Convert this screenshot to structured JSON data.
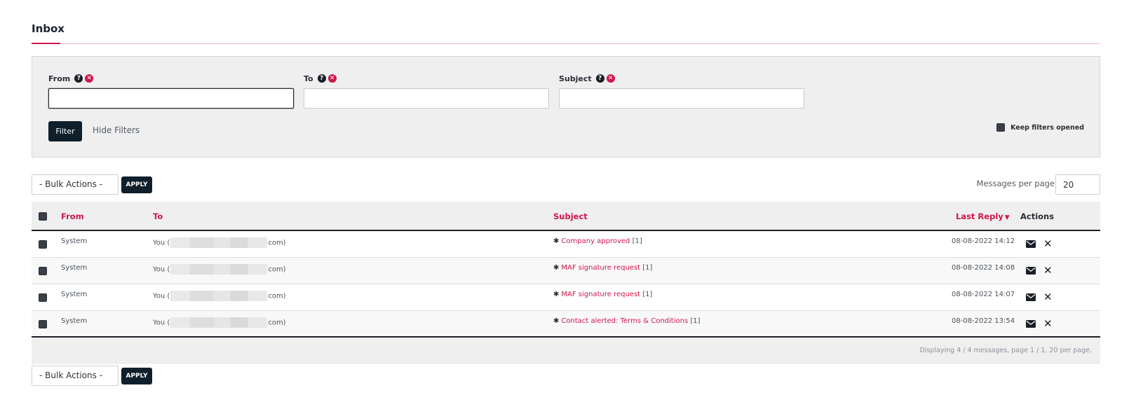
{
  "page": {
    "title": "Inbox"
  },
  "filters": {
    "from_label": "From",
    "to_label": "To",
    "subject_label": "Subject",
    "from_value": "",
    "to_value": "",
    "subject_value": "",
    "filter_button": "Filter",
    "hide_filters": "Hide Filters",
    "keep_filters_opened": "Keep filters opened"
  },
  "bulk": {
    "select_label": "- Bulk Actions -",
    "apply_label": "APPLY",
    "messages_per_page_label": "Messages per page",
    "messages_per_page_value": "20"
  },
  "table": {
    "columns": {
      "from": "From",
      "to": "To",
      "subject": "Subject",
      "last_reply": "Last Reply",
      "actions": "Actions"
    },
    "rows": [
      {
        "from": "System",
        "to_prefix": "You (",
        "to_suffix": "com)",
        "subject": "Company approved",
        "count": "[1]",
        "last_reply": "08-08-2022 14:12"
      },
      {
        "from": "System",
        "to_prefix": "You (",
        "to_suffix": "com)",
        "subject": "MAF signature request",
        "count": "[1]",
        "last_reply": "08-08-2022 14:08"
      },
      {
        "from": "System",
        "to_prefix": "You (",
        "to_suffix": "com)",
        "subject": "MAF signature request",
        "count": "[1]",
        "last_reply": "08-08-2022 14:07"
      },
      {
        "from": "System",
        "to_prefix": "You (",
        "to_suffix": "com)",
        "subject": "Contact alerted: Terms & Conditions",
        "count": "[1]",
        "last_reply": "08-08-2022 13:54"
      }
    ],
    "footer_info": "Displaying 4 / 4 messages, page 1 / 1, 20 per page."
  },
  "colors": {
    "accent": "#d0174b",
    "dark": "#0f1f2b",
    "panel": "#efefef"
  },
  "icons": [
    "help-icon",
    "clear-icon",
    "mail-icon",
    "delete-icon",
    "sort-down-icon",
    "star-icon"
  ]
}
